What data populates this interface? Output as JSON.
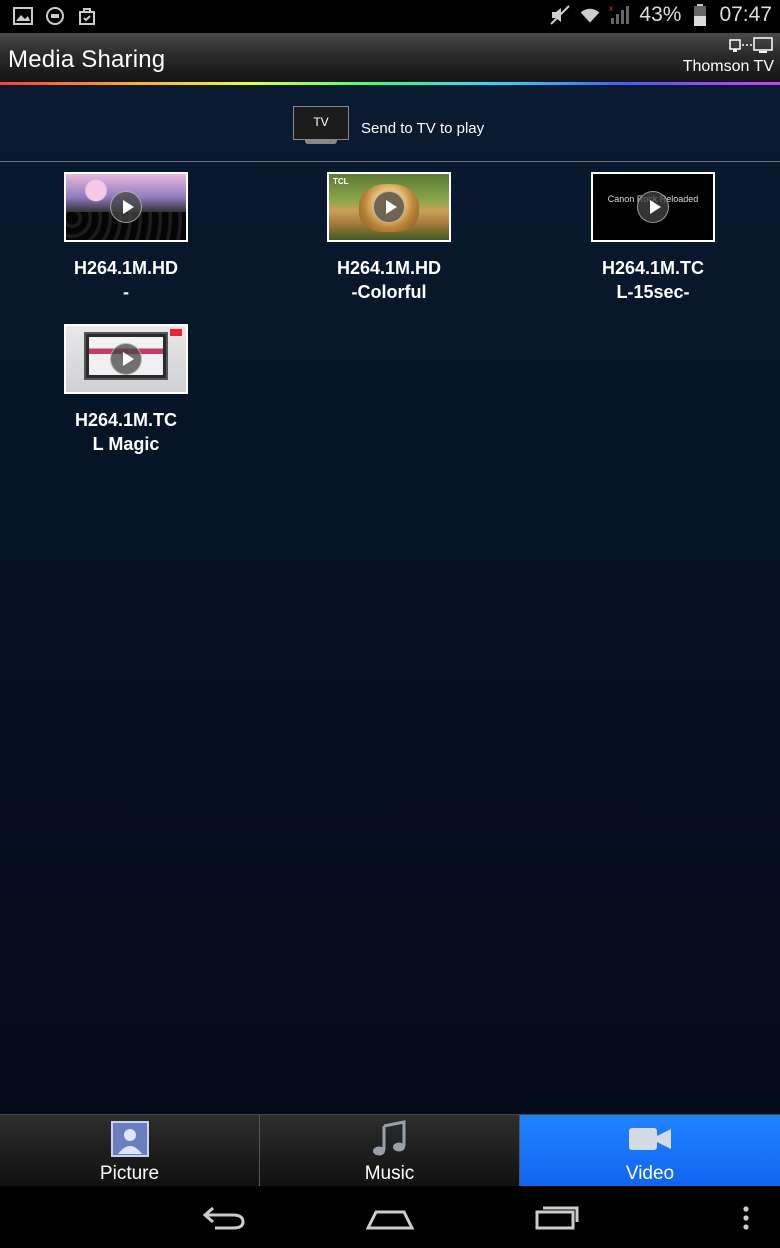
{
  "status": {
    "battery": "43%",
    "time": "07:47"
  },
  "header": {
    "title": "Media Sharing",
    "device_name": "Thomson TV"
  },
  "send": {
    "tv_label": "TV",
    "label": "Send to TV to play"
  },
  "videos": [
    {
      "line1": "H264.1M.HD",
      "line2": "-"
    },
    {
      "line1": "H264.1M.HD",
      "line2": "-Colorful",
      "thumb_logo": "TCL"
    },
    {
      "line1": "H264.1M.TC",
      "line2": "L-15sec-",
      "thumb_text": "Canon Rock Reloaded"
    },
    {
      "line1": "H264.1M.TC",
      "line2": "L Magic"
    }
  ],
  "tabs": [
    {
      "label": "Picture",
      "icon": "picture-icon"
    },
    {
      "label": "Music",
      "icon": "music-icon"
    },
    {
      "label": "Video",
      "icon": "video-icon",
      "active": true
    }
  ],
  "colors": {
    "active_tab": "#1a6ff5",
    "background": "#061326"
  }
}
